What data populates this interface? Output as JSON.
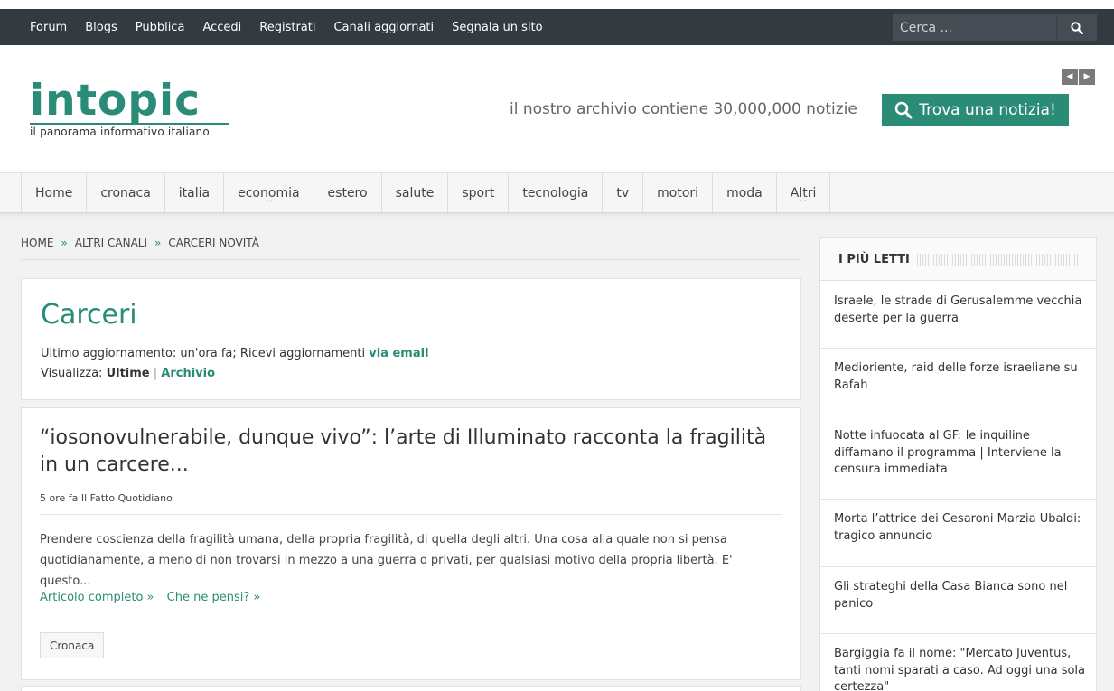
{
  "topnav": {
    "items": [
      "Forum",
      "Blogs",
      "Pubblica",
      "Accedi",
      "Registrati",
      "Canali aggiornati",
      "Segnala un sito"
    ],
    "search_placeholder": "Cerca ..."
  },
  "header": {
    "logo_text": "intopic",
    "logo_sub": "il panorama informativo italiano",
    "archive_text": "il nostro archivio contiene 30,000,000 notizie",
    "trova_label": "Trova una notizia!"
  },
  "mainnav": {
    "items": [
      "Home",
      "cronaca",
      "italia",
      "economia",
      "estero",
      "salute",
      "sport",
      "tecnologia",
      "tv",
      "motori",
      "moda",
      "Altri"
    ]
  },
  "breadcrumb": {
    "items": [
      "HOME",
      "ALTRI CANALI",
      "CARCERI NOVITÀ"
    ]
  },
  "channel": {
    "title": "Carceri",
    "update_text": "Ultimo aggiornamento: un'ora fa; Ricevi aggiornamenti",
    "email_link": "via email",
    "view_label": "Visualizza:",
    "view_current": "Ultime",
    "view_sep": "|",
    "view_archive": "Archivio"
  },
  "article": {
    "title": "“iosonovulnerabile, dunque vivo”: l’arte di Illuminato racconta la fragilità in un carcere...",
    "meta": "5 ore fa Il Fatto Quotidiano",
    "body": "Prendere coscienza della fragilità umana, della propria fragilità, di quella degli altri. Una cosa alla quale non si pensa quotidianamente, a meno di non trovarsi in mezzo a una guerra o privati, per qualsiasi motivo della propria libertà. E' questo...",
    "link_full": "Articolo completo »",
    "link_comment": "Che ne pensi? »",
    "tag": "Cronaca"
  },
  "sidebar": {
    "title": "I PIÙ LETTI",
    "items": [
      "Israele, le strade di Gerusalemme vecchia deserte per la guerra",
      "Medioriente, raid delle forze israeliane su Rafah",
      "Notte infuocata al GF: le inquiline diffamano il programma | Interviene la censura immediata",
      "Morta l’attrice dei Cesaroni Marzia Ubaldi: tragico annuncio",
      "Gli strateghi della Casa Bianca sono nel panico",
      "Bargiggia fa il nome: \"Mercato Juventus, tanti nomi sparati a caso. Ad oggi una sola certezza\""
    ]
  },
  "colors": {
    "accent": "#2a8c76",
    "topbar": "#333a40",
    "background": "#f2f2f2"
  }
}
